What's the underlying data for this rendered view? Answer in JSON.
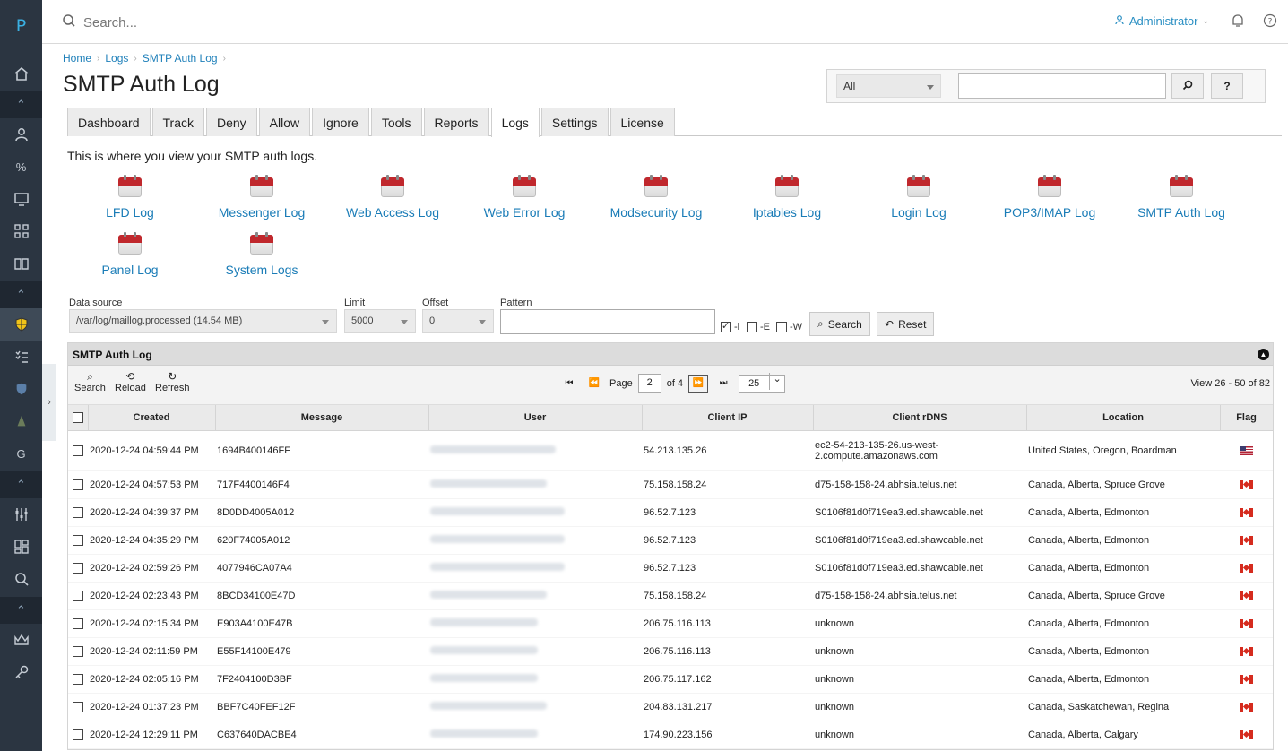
{
  "rail": {
    "logo": "P"
  },
  "topbar": {
    "search_placeholder": "Search...",
    "user": "Administrator"
  },
  "breadcrumb": [
    "Home",
    "Logs",
    "SMTP Auth Log"
  ],
  "title": "SMTP Auth Log",
  "global_search": {
    "scope": "All",
    "go_icon": "search-icon",
    "help_label": "?"
  },
  "tabs": [
    "Dashboard",
    "Track",
    "Deny",
    "Allow",
    "Ignore",
    "Tools",
    "Reports",
    "Logs",
    "Settings",
    "License"
  ],
  "active_tab": "Logs",
  "intro": "This is where you view your SMTP auth logs.",
  "log_links": [
    "LFD Log",
    "Messenger Log",
    "Web Access Log",
    "Web Error Log",
    "Modsecurity Log",
    "Iptables Log",
    "Login Log",
    "POP3/IMAP Log",
    "SMTP Auth Log",
    "Panel Log",
    "System Logs"
  ],
  "filter": {
    "data_source_label": "Data source",
    "data_source": "/var/log/maillog.processed (14.54 MB)",
    "limit_label": "Limit",
    "limit": "5000",
    "offset_label": "Offset",
    "offset": "0",
    "pattern_label": "Pattern",
    "pattern": "",
    "opt_i": "-i",
    "opt_e": "-E",
    "opt_w": "-W",
    "opt_i_checked": true,
    "search_label": "Search",
    "reset_label": "Reset"
  },
  "grid": {
    "title": "SMTP Auth Log",
    "toolbar": [
      "Search",
      "Reload",
      "Refresh"
    ],
    "page_label": "Page",
    "page": "2",
    "of_pages": "of 4",
    "page_size": "25",
    "view_info": "View 26 - 50 of 82",
    "columns": [
      "Created",
      "Message",
      "User",
      "Client IP",
      "Client rDNS",
      "Location",
      "Flag"
    ],
    "rows": [
      {
        "created": "2020-12-24 04:59:44 PM",
        "message": "1694B400146FF",
        "ip": "54.213.135.26",
        "rdns": "ec2-54-213-135-26.us-west-2.compute.amazonaws.com",
        "location": "United States, Oregon, Boardman",
        "flag": "us"
      },
      {
        "created": "2020-12-24 04:57:53 PM",
        "message": "717F4400146F4",
        "ip": "75.158.158.24",
        "rdns": "d75-158-158-24.abhsia.telus.net",
        "location": "Canada, Alberta, Spruce Grove",
        "flag": "ca"
      },
      {
        "created": "2020-12-24 04:39:37 PM",
        "message": "8D0DD4005A012",
        "ip": "96.52.7.123",
        "rdns": "S0106f81d0f719ea3.ed.shawcable.net",
        "location": "Canada, Alberta, Edmonton",
        "flag": "ca"
      },
      {
        "created": "2020-12-24 04:35:29 PM",
        "message": "620F74005A012",
        "ip": "96.52.7.123",
        "rdns": "S0106f81d0f719ea3.ed.shawcable.net",
        "location": "Canada, Alberta, Edmonton",
        "flag": "ca"
      },
      {
        "created": "2020-12-24 02:59:26 PM",
        "message": "4077946CA07A4",
        "ip": "96.52.7.123",
        "rdns": "S0106f81d0f719ea3.ed.shawcable.net",
        "location": "Canada, Alberta, Edmonton",
        "flag": "ca"
      },
      {
        "created": "2020-12-24 02:23:43 PM",
        "message": "8BCD34100E47D",
        "ip": "75.158.158.24",
        "rdns": "d75-158-158-24.abhsia.telus.net",
        "location": "Canada, Alberta, Spruce Grove",
        "flag": "ca"
      },
      {
        "created": "2020-12-24 02:15:34 PM",
        "message": "E903A4100E47B",
        "ip": "206.75.116.113",
        "rdns": "unknown",
        "location": "Canada, Alberta, Edmonton",
        "flag": "ca"
      },
      {
        "created": "2020-12-24 02:11:59 PM",
        "message": "E55F14100E479",
        "ip": "206.75.116.113",
        "rdns": "unknown",
        "location": "Canada, Alberta, Edmonton",
        "flag": "ca"
      },
      {
        "created": "2020-12-24 02:05:16 PM",
        "message": "7F2404100D3BF",
        "ip": "206.75.117.162",
        "rdns": "unknown",
        "location": "Canada, Alberta, Edmonton",
        "flag": "ca"
      },
      {
        "created": "2020-12-24 01:37:23 PM",
        "message": "BBF7C40FEF12F",
        "ip": "204.83.131.217",
        "rdns": "unknown",
        "location": "Canada, Saskatchewan, Regina",
        "flag": "ca"
      },
      {
        "created": "2020-12-24 12:29:11 PM",
        "message": "C637640DACBE4",
        "ip": "174.90.223.156",
        "rdns": "unknown",
        "location": "Canada, Alberta, Calgary",
        "flag": "ca"
      }
    ]
  }
}
